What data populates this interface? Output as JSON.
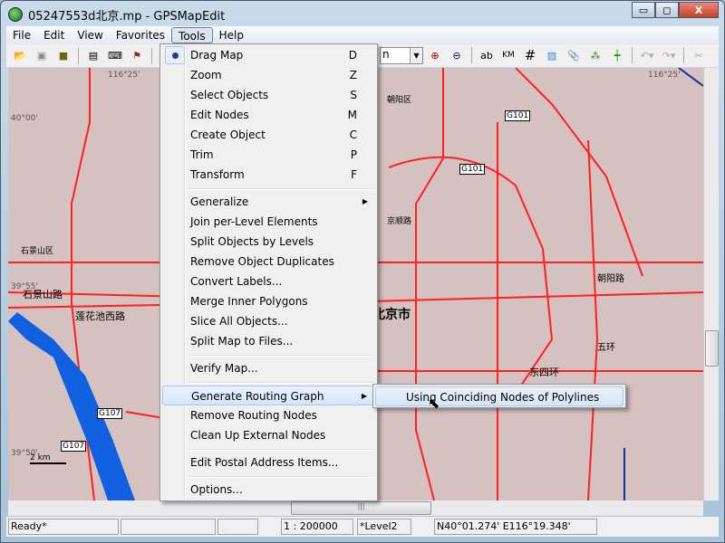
{
  "window": {
    "title": "05247553d北京.mp - GPSMapEdit",
    "minimize": "▭",
    "maximize": "◻",
    "close": "X"
  },
  "menubar": [
    "File",
    "Edit",
    "View",
    "Favorites",
    "Tools",
    "Help"
  ],
  "toolbar": {
    "scale_combo": "n",
    "labels_btn": "ab",
    "km_btn": "KM"
  },
  "map": {
    "labels": {
      "lon1": "116°25'",
      "lon2": "116°25'",
      "lat1": "40°00'",
      "lat2": "39°55'",
      "lat3": "39°50'",
      "g101a": "G101",
      "g101b": "G101",
      "g107a": "G107",
      "g107b": "G107",
      "beijing": "北京市",
      "chaoyang": "朝阳区",
      "chaoyang2": "朝阳路",
      "shijingshan": "石景山区",
      "lianhuachi": "莲花池西路",
      "shijingshanlu": "石景山路",
      "wuhuan": "五环",
      "jingshi": "京顺路",
      "scale": "2 km",
      "dongsi": "东四环"
    }
  },
  "tools_menu": {
    "items": [
      {
        "label": "Drag Map",
        "key": "D"
      },
      {
        "label": "Zoom",
        "key": "Z"
      },
      {
        "label": "Select Objects",
        "key": "S"
      },
      {
        "label": "Edit Nodes",
        "key": "M"
      },
      {
        "label": "Create Object",
        "key": "C"
      },
      {
        "label": "Trim",
        "key": "P"
      },
      {
        "label": "Transform",
        "key": "F"
      },
      {
        "label": "Generalize"
      },
      {
        "label": "Join per-Level Elements"
      },
      {
        "label": "Split Objects by Levels"
      },
      {
        "label": "Remove Object Duplicates"
      },
      {
        "label": "Convert Labels..."
      },
      {
        "label": "Merge Inner Polygons"
      },
      {
        "label": "Slice All Objects..."
      },
      {
        "label": "Split Map to Files..."
      },
      {
        "label": "Verify Map..."
      },
      {
        "label": "Generate Routing Graph"
      },
      {
        "label": "Remove Routing Nodes"
      },
      {
        "label": "Clean Up External Nodes"
      },
      {
        "label": "Edit Postal Address Items..."
      },
      {
        "label": "Options..."
      }
    ]
  },
  "submenu": {
    "item": "Using Coinciding Nodes of Polylines"
  },
  "status": {
    "state": "Ready*",
    "p2": "",
    "p3": "",
    "scale": "1 : 200000",
    "level": "*Level2",
    "coords": "N40°01.274' E116°19.348'"
  }
}
